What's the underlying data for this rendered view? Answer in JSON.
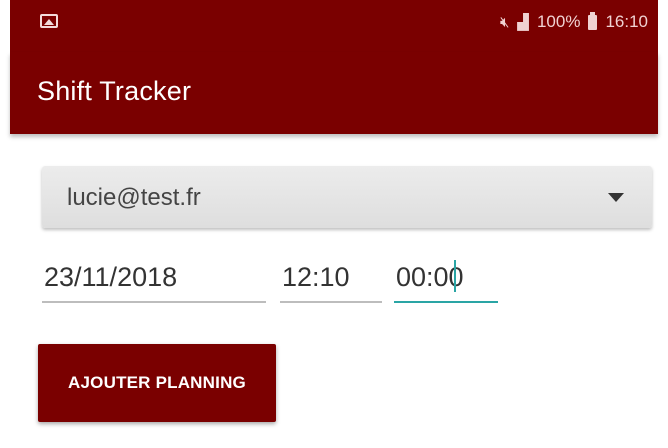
{
  "status_bar": {
    "left_icon": "image-notification-icon",
    "icons": [
      "mute-icon",
      "signal-icon"
    ],
    "battery_text": "100%",
    "battery_icon": "battery-icon",
    "time": "16:10"
  },
  "toolbar": {
    "title": "Shift Tracker"
  },
  "form": {
    "user_select": {
      "selected": "lucie@test.fr"
    },
    "date": "23/11/2018",
    "start_time": "12:10",
    "end_time": "00:00",
    "submit_label": "AJOUTER PLANNING"
  },
  "colors": {
    "primary": "#7a0000",
    "accent": "#2aa5a5"
  }
}
